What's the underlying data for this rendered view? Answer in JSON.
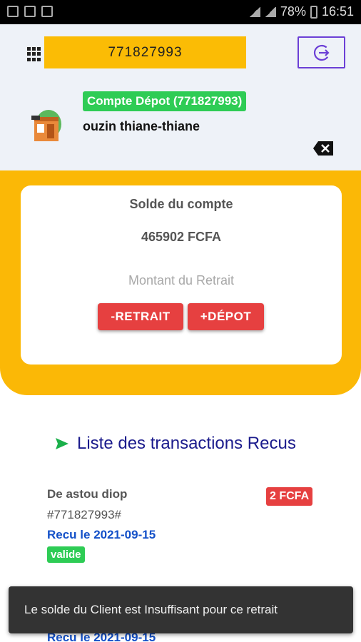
{
  "status_bar": {
    "battery": "78%",
    "time": "16:51"
  },
  "header": {
    "phone_number": "771827993",
    "account_badge": "Compte Dépot (771827993)",
    "client_name": "ouzin thiane-thiane"
  },
  "balance_card": {
    "label": "Solde du compte",
    "value": "465902 FCFA",
    "amount_placeholder": "Montant du Retrait",
    "withdraw_label": "-RETRAIT",
    "deposit_label": "+DÉPOT"
  },
  "transactions": {
    "title": "Liste des transactions Recus",
    "items": [
      {
        "sender": "De astou diop",
        "phone": "#771827993#",
        "date": "Recu le 2021-09-15",
        "status": "valide",
        "amount": "2 FCFA"
      },
      {
        "date": "Recu le 2021-09-15"
      }
    ]
  },
  "toast": {
    "message": "Le solde du Client est Insuffisant pour ce retrait"
  },
  "colors": {
    "accent_yellow": "#fbb806",
    "danger_red": "#e64040",
    "success_green": "#2ecc55",
    "link_blue": "#1350c8",
    "title_navy": "#1b1b8c"
  }
}
